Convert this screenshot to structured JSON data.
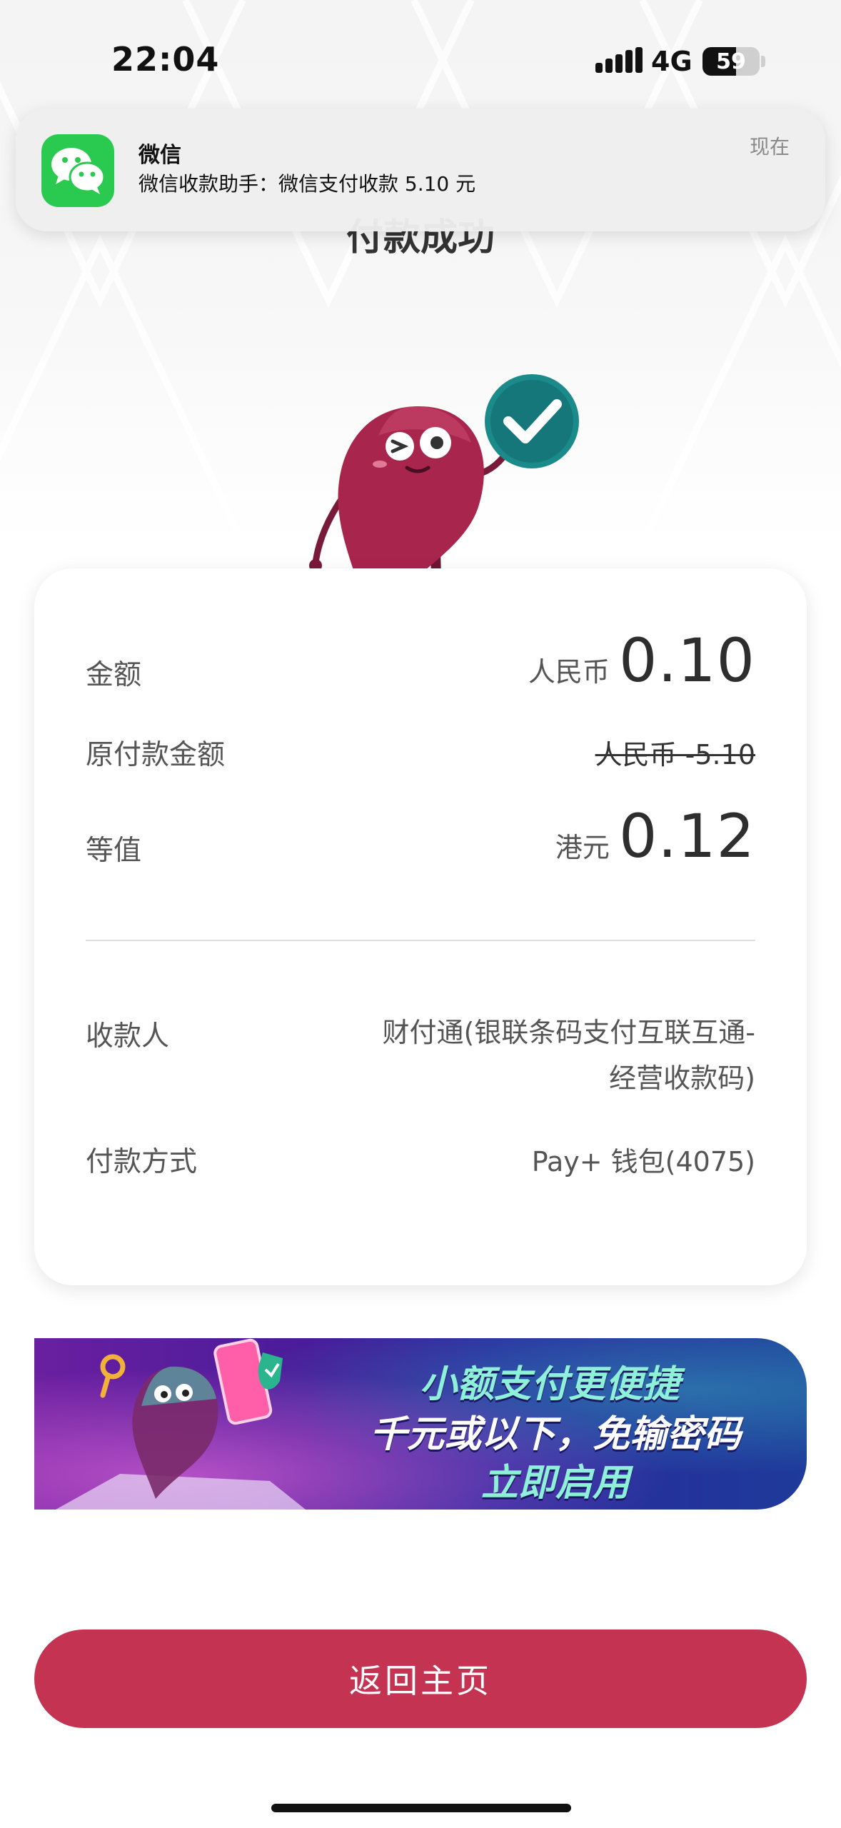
{
  "status_bar": {
    "time": "22:04",
    "network": "4G",
    "battery": "59",
    "battery_level": 0.59
  },
  "notification": {
    "app_name": "微信",
    "message": "微信收款助手：微信支付收款 5.10 元",
    "time": "现在",
    "icon": "wechat-icon"
  },
  "page": {
    "title": "付款成功"
  },
  "card": {
    "amount": {
      "label": "金额",
      "currency": "人民币",
      "value": "0.10"
    },
    "original": {
      "label": "原付款金额",
      "value": "人民币 -5.10"
    },
    "equivalent": {
      "label": "等值",
      "currency": "港元",
      "value": "0.12"
    },
    "payee": {
      "label": "收款人",
      "value": "财付通(银联条码支付互联互通-经营收款码)"
    },
    "method": {
      "label": "付款方式",
      "value": "Pay+ 钱包(4075)"
    }
  },
  "banner": {
    "line1": "小额支付更便捷",
    "line2": "千元或以下，免输密码",
    "line3": "立即启用"
  },
  "actions": {
    "home_label": "返回主页"
  },
  "colors": {
    "accent": "#c43352",
    "mascot": "#a8254d",
    "check_badge": "#1a8a8a",
    "wechat": "#2ac94f"
  }
}
